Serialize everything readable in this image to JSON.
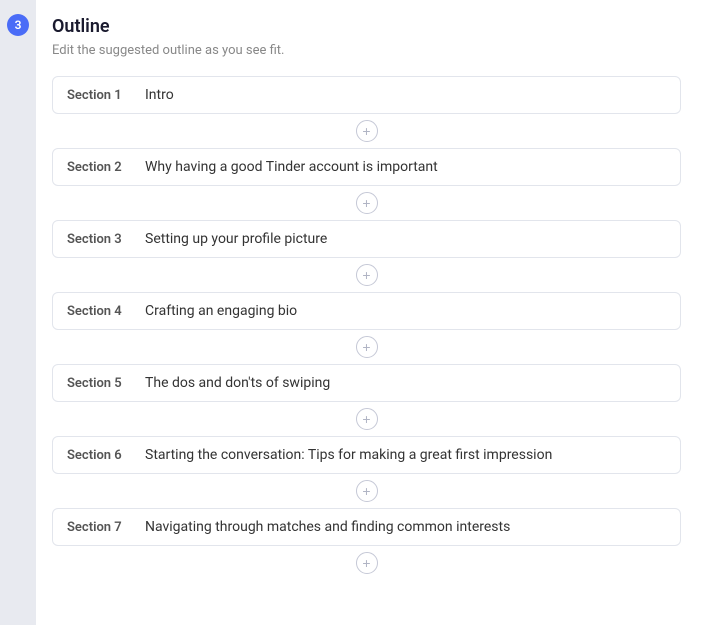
{
  "sidebar": {
    "step_number": "3"
  },
  "header": {
    "title": "Outline",
    "subtitle": "Edit the suggested outline as you see fit."
  },
  "sections": [
    {
      "id": 1,
      "label": "Section 1",
      "text": "Intro"
    },
    {
      "id": 2,
      "label": "Section 2",
      "text": "Why having a good Tinder account is important"
    },
    {
      "id": 3,
      "label": "Section 3",
      "text": "Setting up your profile picture"
    },
    {
      "id": 4,
      "label": "Section 4",
      "text": "Crafting an engaging bio"
    },
    {
      "id": 5,
      "label": "Section 5",
      "text": "The dos and don'ts of swiping"
    },
    {
      "id": 6,
      "label": "Section 6",
      "text": "Starting the conversation: Tips for making a great first impression"
    },
    {
      "id": 7,
      "label": "Section 7",
      "text": "Navigating through matches and finding common interests"
    }
  ],
  "add_button_symbol": "+"
}
